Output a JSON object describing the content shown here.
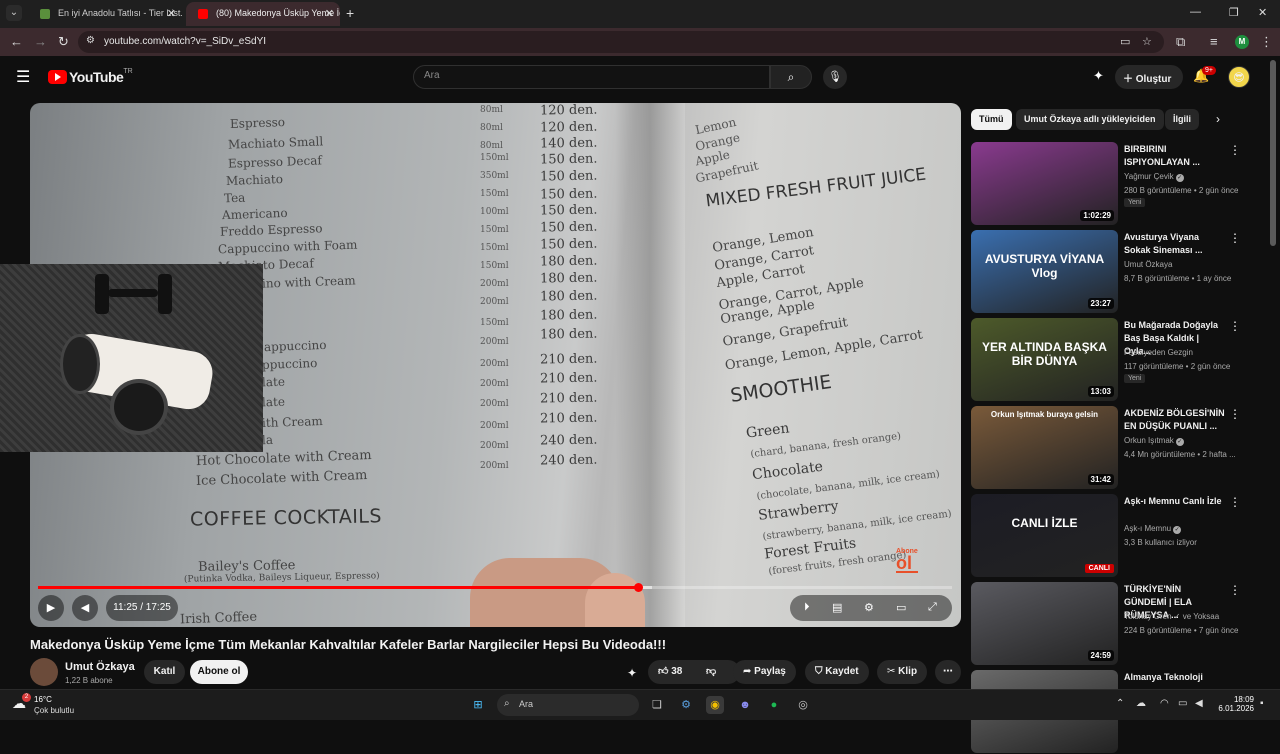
{
  "browser": {
    "tabs": [
      {
        "title": "En iyi Anadolu Tatlısı - Tier List...",
        "active": false
      },
      {
        "title": "(80) Makedonya Üsküp Yeme İç...",
        "active": true
      }
    ],
    "url": "youtube.com/watch?v=_SiDv_eSdYI",
    "profile_initial": "M"
  },
  "yt_header": {
    "logo_text": "YouTube",
    "logo_tm": "TR",
    "search_placeholder": "Ara",
    "create_label": "Oluştur",
    "notification_count": "9+"
  },
  "player": {
    "current_time": "11:25",
    "duration": "17:25",
    "time_display": "11:25 / 17:25",
    "progress": 0.656,
    "buffered": 0.672,
    "overlay_logo_top": "Abone",
    "overlay_logo_bottom": "ol",
    "menu_left": [
      "Espresso",
      "Machiato Small",
      "Espresso Decaf",
      "Machiato",
      "Tea",
      "Americano",
      "Freddo Espresso",
      "Cappuccino with Foam",
      "Machiato Decaf",
      "ino with Cream",
      "appuccino",
      "ppuccino",
      "late",
      "late",
      "ith Cream",
      "la",
      "Hot Chocolate with Cream",
      "Ice Chocolate with Cream"
    ],
    "menu_sizes": [
      "80ml",
      "80ml",
      "80ml",
      "150ml",
      "350ml",
      "150ml",
      "100ml",
      "150ml",
      "150ml",
      "150ml",
      "200ml",
      "200ml",
      "150ml",
      "200ml",
      "200ml",
      "200ml",
      "200ml",
      "200ml",
      "200ml",
      "200ml"
    ],
    "menu_prices": [
      "120 den.",
      "120 den.",
      "140 den.",
      "150 den.",
      "150 den.",
      "150 den.",
      "150 den.",
      "150 den.",
      "150 den.",
      "180 den.",
      "180 den.",
      "180 den.",
      "180 den.",
      "180 den.",
      "210 den.",
      "210 den.",
      "210 den.",
      "210 den.",
      "240 den.",
      "240 den."
    ],
    "coffee_cocktails_heading": "COFFEE COCKTAILS",
    "baileys": "Bailey's Coffee",
    "baileys_desc": "(Putinka Vodka, Baileys Liqueur, Espresso)",
    "irish": "Irish Coffee",
    "right_top": [
      "Lemon",
      "Orange",
      "Apple",
      "Grapefruit"
    ],
    "mixed_heading": "MIXED FRESH FRUIT JUICE",
    "mixed_items": [
      "Orange, Lemon",
      "Orange, Carrot",
      "Apple, Carrot",
      "Orange, Carrot, Apple",
      "Orange, Apple",
      "Orange, Grapefruit",
      "Orange, Lemon, Apple, Carrot"
    ],
    "smoothie_heading": "SMOOTHIE",
    "smoothies": [
      {
        "name": "Green",
        "desc": "(chard, banana, fresh orange)"
      },
      {
        "name": "Chocolate",
        "desc": "(chocolate, banana, milk, ice cream)"
      },
      {
        "name": "Strawberry",
        "desc": "(strawberry, banana, milk, ice cream)"
      },
      {
        "name": "Forest Fruits",
        "desc": "(forest fruits, fresh orange)"
      }
    ]
  },
  "video": {
    "title": "Makedonya Üsküp Yeme İçme Tüm Mekanlar Kahvaltılar Kafeler Barlar Nargileciler Hepsi Bu Videoda!!!",
    "channel": "Umut Özkaya",
    "subscribers": "1,22 B abone",
    "join_label": "Katıl",
    "subscribe_label": "Abone ol",
    "likes": "38",
    "share_label": "Paylaş",
    "save_label": "Kaydet",
    "clip_label": "Klip"
  },
  "sidebar": {
    "chips": [
      "Tümü",
      "Umut Özkaya adlı yükleyiciden",
      "İlgili"
    ],
    "recommendations": [
      {
        "title": "BIRBIRINI ISPIYONLAYAN ...",
        "channel": "Yağmur Çevik",
        "verified": true,
        "meta": "280 B görüntüleme • 2 gün önce",
        "badge": "Yeni",
        "duration": "1:02:29",
        "thumb_text": "",
        "color": "#8a3a8f"
      },
      {
        "title": "Avusturya Viyana Sokak Sineması ...",
        "channel": "Umut Özkaya",
        "verified": false,
        "meta": "8,7 B görüntüleme • 1 ay önce",
        "badge": "",
        "duration": "23:27",
        "thumb_text": "AVUSTURYA VİYANA Vlog",
        "color": "#3a6fb0"
      },
      {
        "title": "Bu Mağarada Doğayla Baş Başa Kaldık | Oyla...",
        "channel": "Fasulyeden Gezgin",
        "verified": false,
        "meta": "117 görüntüleme • 2 gün önce",
        "badge": "Yeni",
        "duration": "13:03",
        "thumb_text": "YER ALTINDA BAŞKA BİR DÜNYA",
        "color": "#4d5a2a"
      },
      {
        "title": "AKDENİZ BÖLGESİ'NİN EN DÜŞÜK PUANLI ...",
        "channel": "Orkun Işıtmak",
        "verified": true,
        "meta": "4,4 Mn görüntüleme • 2 hafta ...",
        "badge": "",
        "duration": "31:42",
        "thumb_text": "Orkun Işıtmak buraya gelsin",
        "color": "#7a5a3a"
      },
      {
        "title": "Aşk-ı Memnu Canlı İzle",
        "channel": "Aşk-ı Memnu",
        "verified": true,
        "meta": "3,3 B kullanıcı izliyor",
        "badge": "",
        "duration": "CANLI",
        "thumb_text": "CANLI İZLE",
        "color": "#1c1c24"
      },
      {
        "title": "TÜRKİYE'NİN GÜNDEMİ | ELA RÜMEYSA ...",
        "channel": "Tolunay Ören ✓ ve Yoksaa",
        "verified": false,
        "meta": "224 B görüntüleme • 7 gün önce",
        "badge": "",
        "duration": "24:59",
        "thumb_text": "",
        "color": "#5a5a60"
      },
      {
        "title": "Almanya Teknoloji",
        "channel": "",
        "verified": false,
        "meta": "",
        "badge": "",
        "duration": "",
        "thumb_text": "",
        "color": "#6a6a6a"
      }
    ]
  },
  "taskbar": {
    "temperature": "16°C",
    "condition": "Çok bulutlu",
    "weather_badge": "2",
    "search_label": "Ara",
    "time": "18:09",
    "date": "6.01.2026"
  }
}
